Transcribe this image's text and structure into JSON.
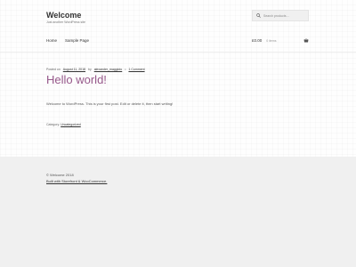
{
  "header": {
    "site_title": "Welcome",
    "site_description": "Just another WordPress site",
    "search_placeholder": "Search products…"
  },
  "nav": {
    "items": [
      "Home",
      "Sample Page"
    ]
  },
  "cart": {
    "amount": "£0.00",
    "items": "0 items"
  },
  "post": {
    "posted_on_label": "Posted on",
    "date": "August 11, 2018",
    "by_label": "by",
    "author": "alexander_maggiolo",
    "separator": "•",
    "comments": "1 Comment",
    "title": "Hello world!",
    "body": "Welcome to WordPress. This is your first post. Edit or delete it, then start writing!",
    "category_label": "Category",
    "category": "Uncategorized"
  },
  "footer": {
    "copyright": "© Welcome 2018",
    "built_with": "Built with Storefront & WooCommerce."
  },
  "colors": {
    "accent": "#96588a",
    "footer_bg": "#f0f0f0"
  }
}
